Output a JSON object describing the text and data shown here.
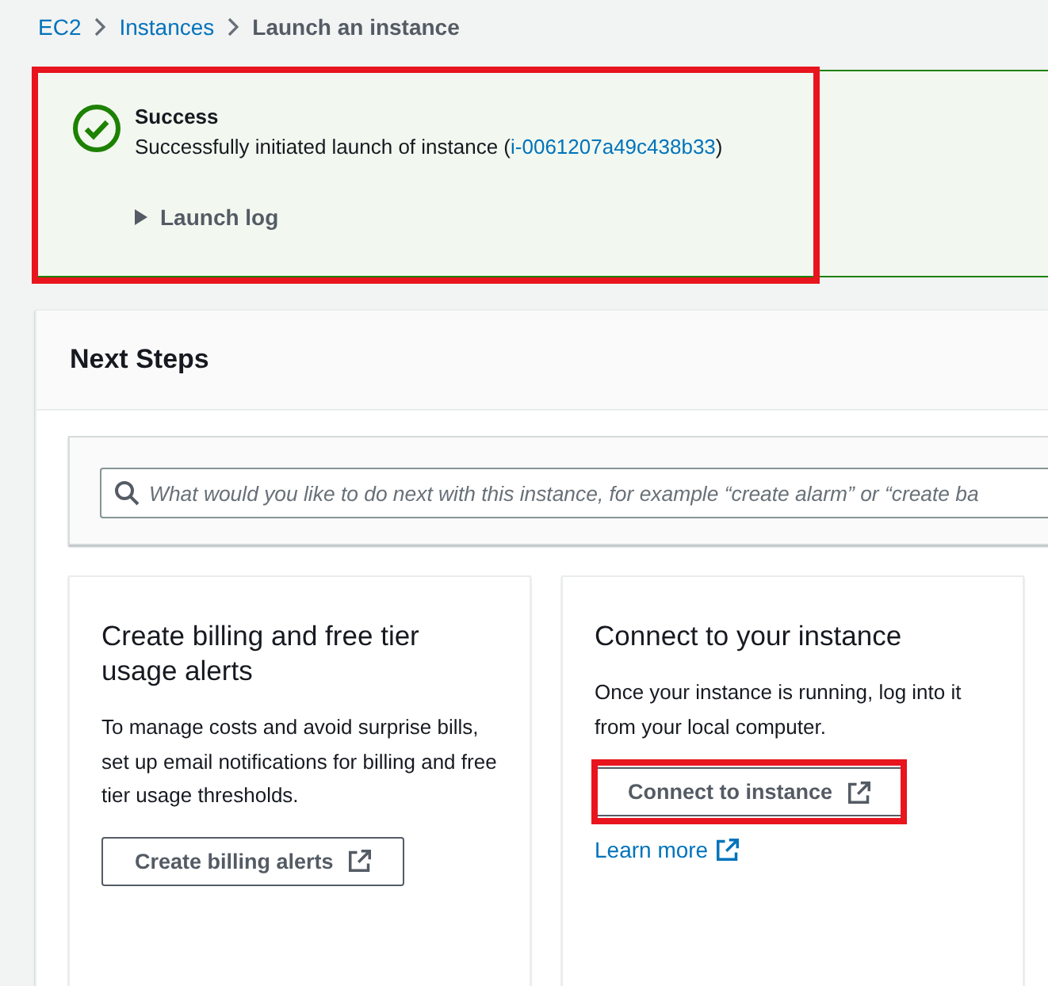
{
  "breadcrumb": [
    {
      "label": "EC2",
      "kind": "link"
    },
    {
      "label": "Instances",
      "kind": "link"
    },
    {
      "label": "Launch an instance",
      "kind": "current"
    }
  ],
  "flash": {
    "title": "Success",
    "message_before": "Successfully initiated launch of instance (",
    "link": "i-0061207a49c438b33",
    "message_after": ")",
    "highlighted": true,
    "log": {
      "label": "Launch log",
      "expanded": false
    }
  },
  "next_steps": {
    "title": "Next Steps",
    "search": {
      "placeholder": "What would you like to do next with this instance, for example “create alarm” or “create ba"
    },
    "cards": [
      {
        "title": "Create billing and free tier usage alerts",
        "description": "To manage costs and avoid surprise bills, set up email notifications for billing and free tier usage thresholds.",
        "button": {
          "label": "Create billing alerts",
          "highlighted": false
        }
      },
      {
        "title": "Connect to your instance",
        "description": "Once your instance is running, log into it from your local computer.",
        "button": {
          "label": "Connect to instance",
          "highlighted": true
        },
        "link": {
          "label": "Learn more"
        }
      }
    ]
  }
}
